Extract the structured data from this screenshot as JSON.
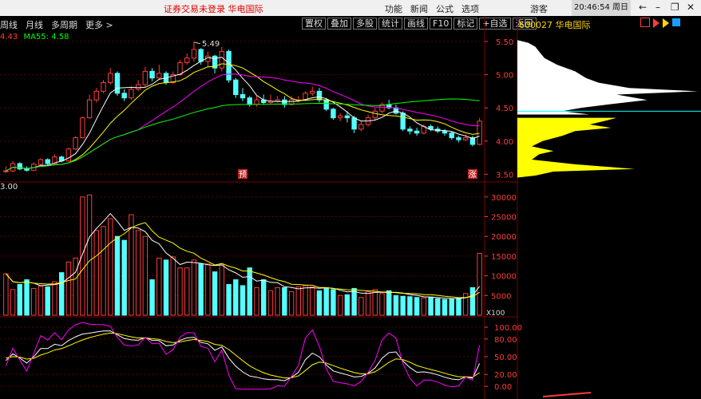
{
  "topbar": {
    "title": "证券交易未登录  华电国际",
    "menu": [
      "功能",
      "新闻",
      "公式",
      "选项"
    ],
    "user": "游客",
    "clock": "20:46:54 周日"
  },
  "toolbar": {
    "periods": [
      "周线",
      "月线",
      "多周期",
      "更多 >"
    ],
    "buttons": [
      "置权",
      "叠加",
      "多股",
      "统计",
      "画线",
      "F10",
      "标记",
      "+自选",
      "返回"
    ],
    "stock": "600027 华电国际"
  },
  "ma_label": {
    "ma55_prefix": "MA55:",
    "ma55_value": "4.58",
    "partial_value": "4.43"
  },
  "volume_label": "3.00",
  "price_axis": [
    "5.50",
    "5.00",
    "4.50",
    "4.00",
    "3.50"
  ],
  "volume_axis": [
    "30000",
    "25000",
    "20000",
    "15000",
    "10000",
    "5000"
  ],
  "volume_unit": "X100",
  "indicator_axis": [
    "100.00",
    "80.00",
    "50.00",
    "20.00",
    "0.00"
  ],
  "high_label": "5.49",
  "markers": [
    "预",
    "涨"
  ],
  "colors": {
    "up": "#ff3b3b",
    "down": "#54ffff",
    "ma5": "#ffffff",
    "ma10": "#ffff00",
    "ma20": "#ff00ff",
    "ma55": "#00ff00",
    "grid": "#7a0000",
    "axis_text": "#ff3b3b"
  },
  "chart_data": {
    "type": "candlestick",
    "candles": [
      [
        3.55,
        3.55,
        3.62,
        3.52
      ],
      [
        3.55,
        3.66,
        3.7,
        3.53
      ],
      [
        3.66,
        3.58,
        3.68,
        3.56
      ],
      [
        3.58,
        3.56,
        3.62,
        3.54
      ],
      [
        3.56,
        3.65,
        3.68,
        3.55
      ],
      [
        3.65,
        3.72,
        3.74,
        3.63
      ],
      [
        3.72,
        3.66,
        3.74,
        3.64
      ],
      [
        3.66,
        3.76,
        3.8,
        3.65
      ],
      [
        3.76,
        3.7,
        3.78,
        3.68
      ],
      [
        3.7,
        3.88,
        3.9,
        3.69
      ],
      [
        3.88,
        4.05,
        4.07,
        3.86
      ],
      [
        4.05,
        4.35,
        4.37,
        4.04
      ],
      [
        4.35,
        4.62,
        4.7,
        4.33
      ],
      [
        4.62,
        4.75,
        4.8,
        4.58
      ],
      [
        4.75,
        4.88,
        4.92,
        4.72
      ],
      [
        4.88,
        5.02,
        5.1,
        4.85
      ],
      [
        5.02,
        4.72,
        5.05,
        4.68
      ],
      [
        4.72,
        4.65,
        4.78,
        4.6
      ],
      [
        4.65,
        4.78,
        4.82,
        4.62
      ],
      [
        4.78,
        4.85,
        4.92,
        4.75
      ],
      [
        4.85,
        5.05,
        5.12,
        4.82
      ],
      [
        5.05,
        4.95,
        5.1,
        4.9
      ],
      [
        4.95,
        5.02,
        5.15,
        4.92
      ],
      [
        5.02,
        4.88,
        5.05,
        4.85
      ],
      [
        4.88,
        5.0,
        5.05,
        4.86
      ],
      [
        5.0,
        5.18,
        5.22,
        4.98
      ],
      [
        5.18,
        5.25,
        5.32,
        5.15
      ],
      [
        5.25,
        5.38,
        5.49,
        5.2
      ],
      [
        5.38,
        5.2,
        5.4,
        5.15
      ],
      [
        5.2,
        5.28,
        5.35,
        5.12
      ],
      [
        5.28,
        5.1,
        5.3,
        5.02
      ],
      [
        5.1,
        5.35,
        5.42,
        5.05
      ],
      [
        5.35,
        4.92,
        5.38,
        4.88
      ],
      [
        4.92,
        4.7,
        4.95,
        4.65
      ],
      [
        4.7,
        4.65,
        4.8,
        4.6
      ],
      [
        4.65,
        4.55,
        4.68,
        4.52
      ],
      [
        4.55,
        4.62,
        4.68,
        4.52
      ],
      [
        4.62,
        4.58,
        4.7,
        4.55
      ],
      [
        4.58,
        4.6,
        4.7,
        4.55
      ],
      [
        4.6,
        4.62,
        4.68,
        4.58
      ],
      [
        4.62,
        4.55,
        4.68,
        4.5
      ],
      [
        4.55,
        4.62,
        4.68,
        4.54
      ],
      [
        4.62,
        4.62,
        4.68,
        4.58
      ],
      [
        4.62,
        4.72,
        4.75,
        4.6
      ],
      [
        4.72,
        4.75,
        4.82,
        4.68
      ],
      [
        4.75,
        4.62,
        4.8,
        4.58
      ],
      [
        4.62,
        4.48,
        4.65,
        4.45
      ],
      [
        4.48,
        4.35,
        4.5,
        4.32
      ],
      [
        4.35,
        4.38,
        4.42,
        4.3
      ],
      [
        4.38,
        4.35,
        4.45,
        4.28
      ],
      [
        4.35,
        4.18,
        4.38,
        4.12
      ],
      [
        4.18,
        4.25,
        4.3,
        4.15
      ],
      [
        4.25,
        4.35,
        4.4,
        4.22
      ],
      [
        4.35,
        4.45,
        4.5,
        4.32
      ],
      [
        4.45,
        4.55,
        4.58,
        4.42
      ],
      [
        4.55,
        4.5,
        4.62,
        4.48
      ],
      [
        4.5,
        4.42,
        4.55,
        4.4
      ],
      [
        4.42,
        4.18,
        4.45,
        4.15
      ],
      [
        4.18,
        4.15,
        4.22,
        4.1
      ],
      [
        4.15,
        4.12,
        4.2,
        4.08
      ],
      [
        4.12,
        4.22,
        4.25,
        4.1
      ],
      [
        4.22,
        4.18,
        4.25,
        4.15
      ],
      [
        4.18,
        4.15,
        4.22,
        4.12
      ],
      [
        4.15,
        4.12,
        4.18,
        4.08
      ],
      [
        4.12,
        4.05,
        4.15,
        4.02
      ],
      [
        4.05,
        4.02,
        4.08,
        3.98
      ],
      [
        4.02,
        4.05,
        4.1,
        4.0
      ],
      [
        4.05,
        3.95,
        4.08,
        3.92
      ],
      [
        3.95,
        4.3,
        4.35,
        3.94
      ]
    ],
    "volumes": [
      10500,
      6500,
      7800,
      9000,
      6800,
      7400,
      7200,
      8500,
      10800,
      13500,
      14500,
      30000,
      30500,
      21500,
      22500,
      24500,
      20000,
      19000,
      25500,
      21500,
      20000,
      9000,
      14500,
      14000,
      14800,
      12000,
      12000,
      14000,
      13000,
      13000,
      11000,
      12800,
      7800,
      9000,
      7500,
      12000,
      7000,
      9000,
      6200,
      7000,
      7000,
      6000,
      7200,
      7500,
      7200,
      6200,
      6800,
      6500,
      5000,
      5200,
      6800,
      4500,
      6000,
      6500,
      5500,
      6200,
      5000,
      4800,
      4700,
      4500,
      4400,
      4600,
      4200,
      4000,
      4100,
      4300,
      5500,
      7000,
      15700
    ],
    "ylim": [
      3.42,
      5.62
    ],
    "vol_ylim": [
      0,
      33000
    ],
    "volume_profile": [
      [
        5.52,
        0
      ],
      [
        5.48,
        0.06
      ],
      [
        5.42,
        0.1
      ],
      [
        5.35,
        0.12
      ],
      [
        5.25,
        0.15
      ],
      [
        5.15,
        0.22
      ],
      [
        5.05,
        0.32
      ],
      [
        4.95,
        0.38
      ],
      [
        4.88,
        0.45
      ],
      [
        4.8,
        0.62
      ],
      [
        4.75,
        1.0
      ],
      [
        4.7,
        0.55
      ],
      [
        4.62,
        0.72
      ],
      [
        4.55,
        0.5
      ],
      [
        4.5,
        0.35
      ],
      [
        4.45,
        0.25
      ],
      [
        4.4,
        0.4
      ],
      [
        4.35,
        0.55
      ],
      [
        4.3,
        0.48
      ],
      [
        4.25,
        0.4
      ],
      [
        4.2,
        0.52
      ],
      [
        4.15,
        0.32
      ],
      [
        4.08,
        0.25
      ],
      [
        4.0,
        0.14
      ],
      [
        3.92,
        0.08
      ],
      [
        3.85,
        0.2
      ],
      [
        3.8,
        0.12
      ],
      [
        3.72,
        0.08
      ],
      [
        3.65,
        0.32
      ],
      [
        3.58,
        0.65
      ],
      [
        3.54,
        0.2
      ],
      [
        3.48,
        0.1
      ],
      [
        3.45,
        0
      ]
    ],
    "profile_split": 4.38,
    "profile_line": 4.45
  }
}
